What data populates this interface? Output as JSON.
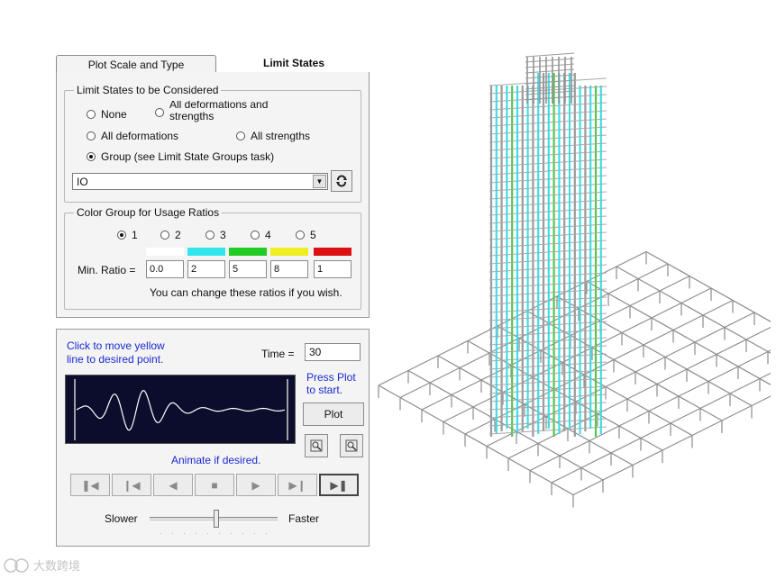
{
  "tabs": {
    "plot_scale": "Plot Scale and Type",
    "limit_states": "Limit States"
  },
  "limit_states_group": {
    "title": "Limit States to be Considered",
    "options": {
      "none": "None",
      "all_def_strength": "All deformations and strengths",
      "all_deformations": "All deformations",
      "all_strengths": "All strengths",
      "group": "Group (see Limit State Groups task)"
    },
    "selected": "group",
    "combo_value": "IO"
  },
  "color_group": {
    "title": "Color Group for Usage Ratios",
    "options": [
      "1",
      "2",
      "3",
      "4",
      "5"
    ],
    "selected": "1",
    "colors": [
      "#ffffff",
      "#33e6ee",
      "#22cc22",
      "#eeee22",
      "#dd1111"
    ],
    "min_ratio_label": "Min. Ratio =",
    "ratios": [
      "0.0",
      "2",
      "5",
      "8",
      "1"
    ],
    "hint": "You can change these ratios if you wish."
  },
  "animation": {
    "instruction": "Click to move yellow line to desired point.",
    "time_label": "Time =",
    "time_value": "30",
    "press_plot": "Press Plot to start.",
    "plot_button": "Plot",
    "animate_hint": "Animate if desired.",
    "slower": "Slower",
    "faster": "Faster",
    "speed_fraction": 0.52
  },
  "watermark": "大数跨境",
  "icons": {
    "combo": "chevron-down-icon",
    "refresh": "refresh-icon",
    "zoom_in": "zoom-in-icon",
    "zoom_out": "zoom-out-icon",
    "nav": [
      "skip-to-start-icon",
      "step-back-icon",
      "play-reverse-icon",
      "stop-icon",
      "play-icon",
      "step-forward-icon",
      "play-pause-icon"
    ]
  }
}
